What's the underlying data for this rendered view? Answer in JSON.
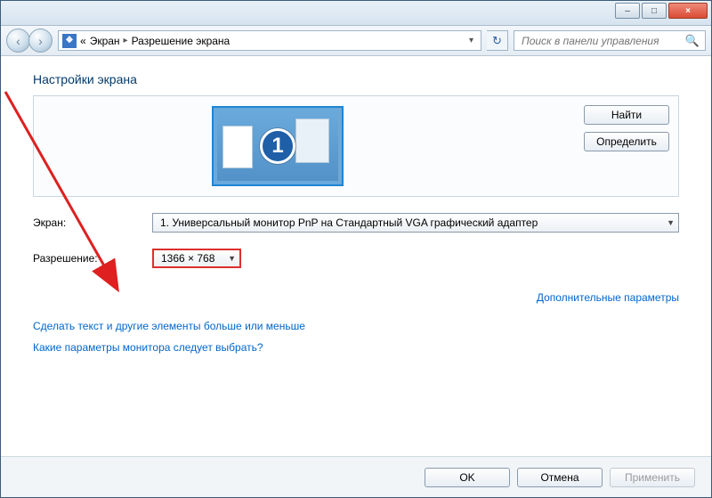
{
  "titlebar": {
    "min": "–",
    "max": "□",
    "close": "×"
  },
  "nav": {
    "back": "‹",
    "forward": "›",
    "crumb_prefix": "«",
    "crumb1": "Экран",
    "crumb2": "Разрешение экрана",
    "refresh": "↻",
    "search_placeholder": "Поиск в панели управления"
  },
  "page": {
    "title": "Настройки экрана",
    "monitor_number": "1",
    "find_btn": "Найти",
    "detect_btn": "Определить"
  },
  "form": {
    "screen_label": "Экран:",
    "screen_value": "1. Универсальный монитор PnP на Стандартный VGA графический адаптер",
    "resolution_label": "Разрешение:",
    "resolution_value": "1366 × 768"
  },
  "links": {
    "advanced": "Дополнительные параметры",
    "text_size": "Сделать текст и другие элементы больше или меньше",
    "which_settings": "Какие параметры монитора следует выбрать?"
  },
  "buttons": {
    "ok": "OK",
    "cancel": "Отмена",
    "apply": "Применить"
  }
}
